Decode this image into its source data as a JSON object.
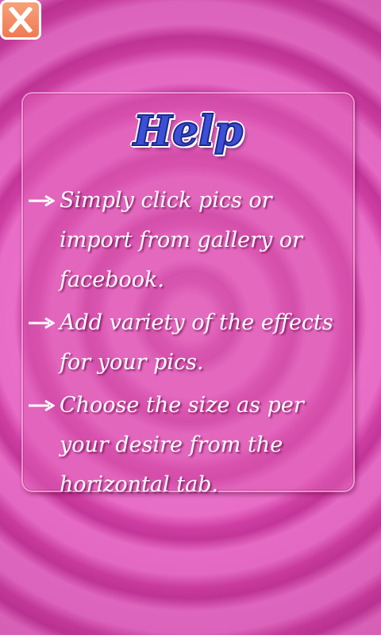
{
  "close_button": {
    "label": "X"
  },
  "help": {
    "title": "Help",
    "items": [
      "Simply click pics or import from gallery or facebook.",
      "Add variety of the effects for your pics.",
      "Choose the size as per your desire from the horizontal tab."
    ]
  },
  "colors": {
    "background": "#d23fa4",
    "close_button": "#ef7a52",
    "title": "#3d4fd6",
    "text": "#ffffff"
  }
}
